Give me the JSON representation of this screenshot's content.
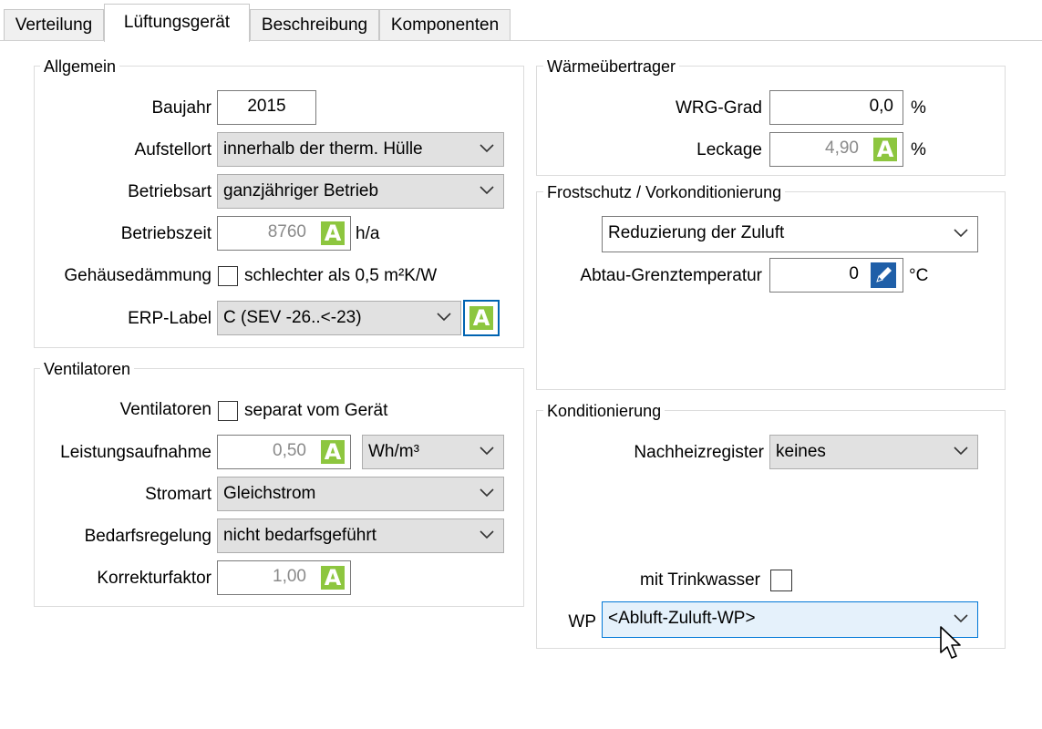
{
  "tabs": [
    {
      "label": "Verteilung",
      "active": false
    },
    {
      "label": "Lüftungsgerät",
      "active": true
    },
    {
      "label": "Beschreibung",
      "active": false
    },
    {
      "label": "Komponenten",
      "active": false
    }
  ],
  "allgemein": {
    "title": "Allgemein",
    "baujahr_label": "Baujahr",
    "baujahr_value": "2015",
    "aufstellort_label": "Aufstellort",
    "aufstellort_value": "innerhalb der therm. Hülle",
    "betriebsart_label": "Betriebsart",
    "betriebsart_value": "ganzjähriger Betrieb",
    "betriebszeit_label": "Betriebszeit",
    "betriebszeit_value": "8760",
    "betriebszeit_unit": "h/a",
    "gehaeuse_label": "Gehäusedämmung",
    "gehaeuse_checkbox_label": "schlechter als 0,5 m²K/W",
    "gehaeuse_checked": false,
    "erp_label": "ERP-Label",
    "erp_value": "C (SEV -26..<-23)"
  },
  "ventilatoren": {
    "title": "Ventilatoren",
    "ventilatoren_label": "Ventilatoren",
    "ventilatoren_checkbox_label": "separat vom Gerät",
    "ventilatoren_checked": false,
    "leistung_label": "Leistungsaufnahme",
    "leistung_value": "0,50",
    "leistung_unit": "Wh/m³",
    "stromart_label": "Stromart",
    "stromart_value": "Gleichstrom",
    "bedarf_label": "Bedarfsregelung",
    "bedarf_value": "nicht bedarfsgeführt",
    "korrektur_label": "Korrekturfaktor",
    "korrektur_value": "1,00"
  },
  "waermeuebertrager": {
    "title": "Wärmeübertrager",
    "wrg_label": "WRG-Grad",
    "wrg_value": "0,0",
    "wrg_unit": "%",
    "leckage_label": "Leckage",
    "leckage_value": "4,90",
    "leckage_unit": "%"
  },
  "frostschutz": {
    "title": "Frostschutz / Vorkonditionierung",
    "mode_value": "Reduzierung der Zuluft",
    "abtau_label": "Abtau-Grenztemperatur",
    "abtau_value": "0",
    "abtau_unit": "°C"
  },
  "konditionierung": {
    "title": "Konditionierung",
    "nachheiz_label": "Nachheizregister",
    "nachheiz_value": "keines",
    "trinkwasser_label": "mit Trinkwasser",
    "trinkwasser_checked": false,
    "wp_label": "WP",
    "wp_value": "<Abluft-Zuluft-WP>"
  },
  "badge_letter": "A",
  "colors": {
    "badge_green": "#8dc63f",
    "pen_blue": "#1f5fa8",
    "focus_blue": "#0078d7"
  }
}
